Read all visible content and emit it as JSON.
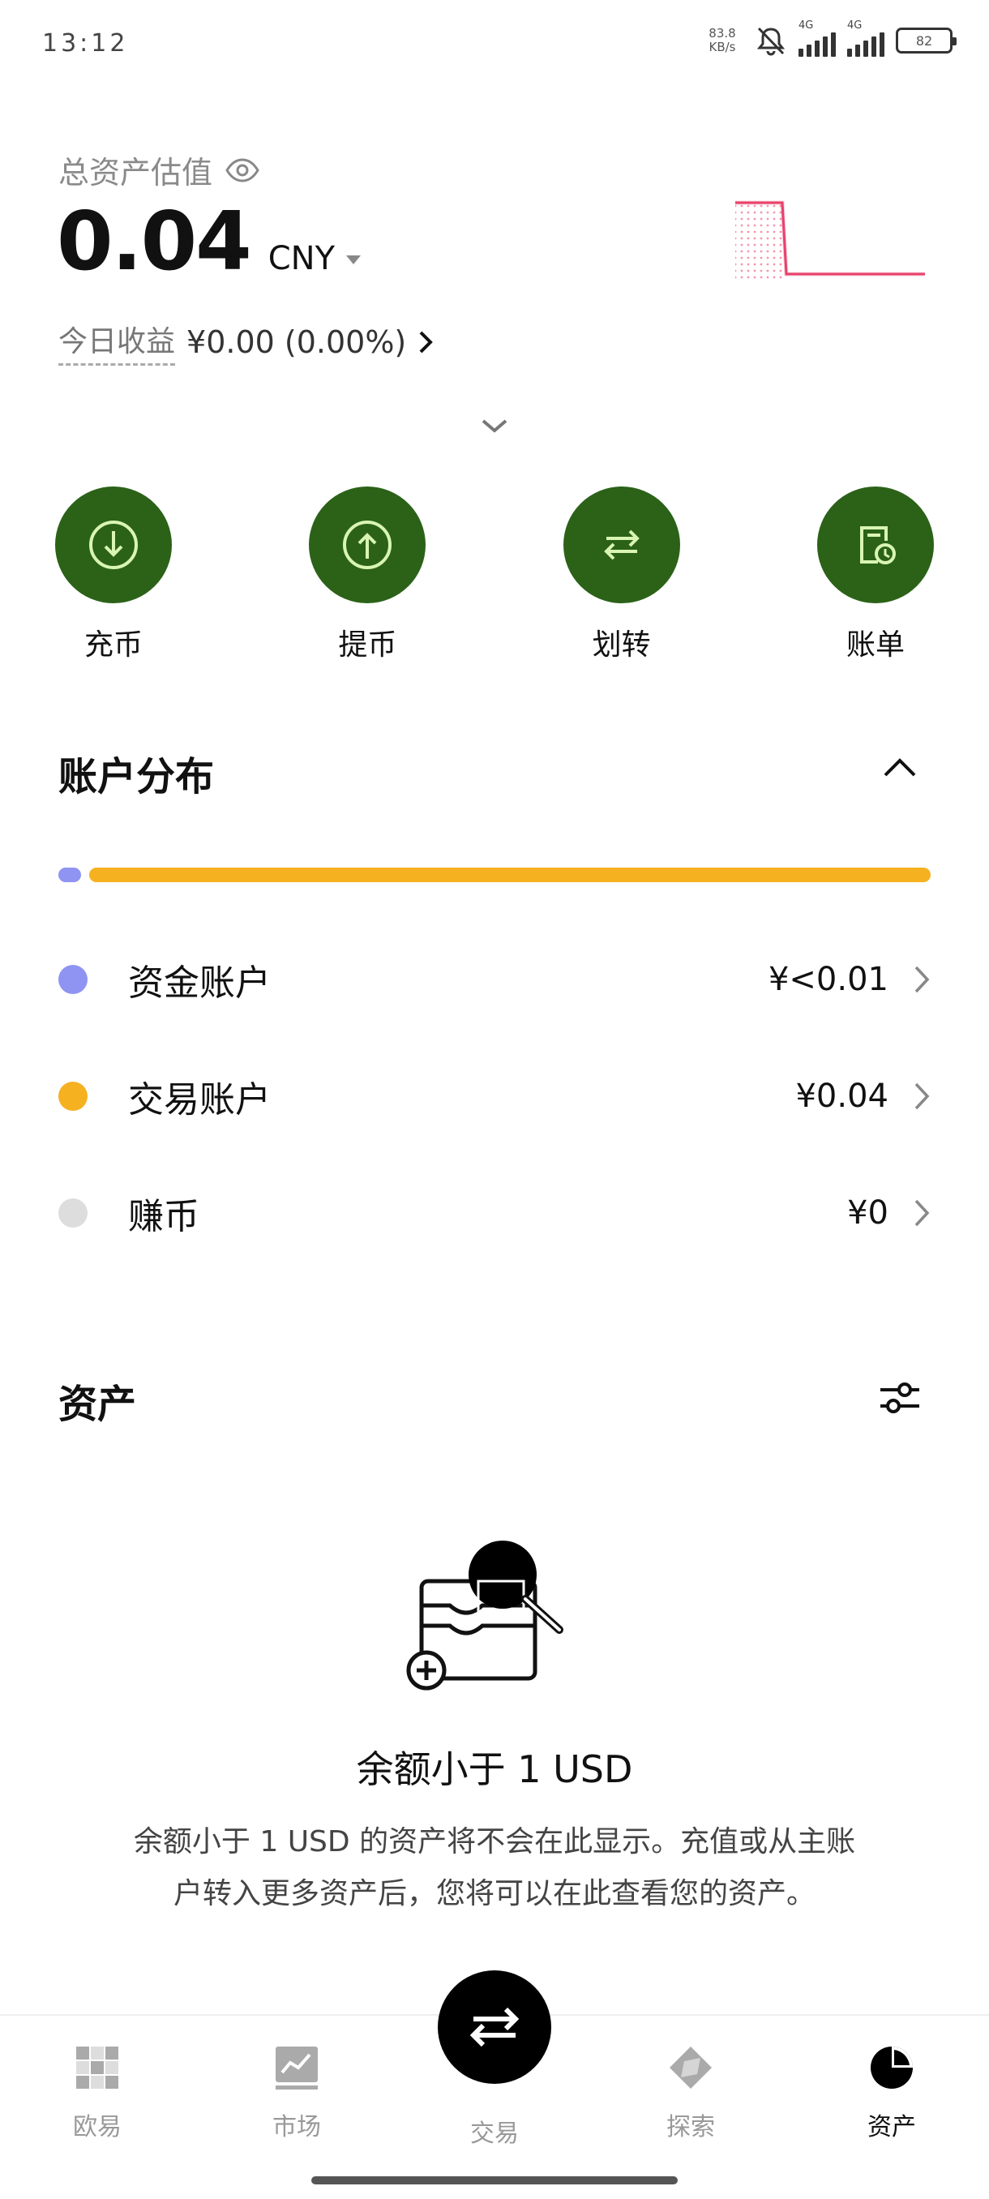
{
  "status_bar": {
    "time": "13:12",
    "net_speed_value": "83.8",
    "net_speed_unit": "KB/s",
    "signal_1_type": "4G",
    "signal_2_type": "4G",
    "battery": "82"
  },
  "header": {
    "asset_label": "总资产估值",
    "total_value": "0.04",
    "currency": "CNY",
    "today_label": "今日收益",
    "today_value": "¥0.00 (0.00%)",
    "sparkline_color": "#e8416b"
  },
  "actions": [
    {
      "label": "充币",
      "icon": "deposit-icon"
    },
    {
      "label": "提币",
      "icon": "withdraw-icon"
    },
    {
      "label": "划转",
      "icon": "transfer-icon"
    },
    {
      "label": "账单",
      "icon": "bill-icon"
    }
  ],
  "distribution": {
    "title": "账户分布",
    "segments": [
      {
        "name": "资金账户",
        "share": 0.02,
        "color": "#8f94f2"
      },
      {
        "name": "交易账户",
        "share": 0.98,
        "color": "#f6b121"
      }
    ],
    "accounts": [
      {
        "name": "资金账户",
        "value": "¥<0.01",
        "color": "#8f94f2"
      },
      {
        "name": "交易账户",
        "value": "¥0.04",
        "color": "#f6b121"
      },
      {
        "name": "赚币",
        "value": "¥0",
        "color": "#dddddd"
      }
    ]
  },
  "assets": {
    "title": "资产",
    "empty_title": "余额小于 1 USD",
    "empty_desc": "余额小于 1 USD 的资产将不会在此显示。充值或从主账户转入更多资产后，您将可以在此查看您的资产。"
  },
  "bottom_nav": {
    "items": [
      {
        "label": "欧易",
        "icon": "okx-logo-icon"
      },
      {
        "label": "市场",
        "icon": "market-chart-icon"
      },
      {
        "label": "交易",
        "icon": "trade-swap-icon"
      },
      {
        "label": "探索",
        "icon": "compass-icon"
      },
      {
        "label": "资产",
        "icon": "pie-chart-icon"
      }
    ],
    "active": "资产"
  },
  "colors": {
    "action_green": "#2b6218",
    "action_icon": "#d9f5b5"
  }
}
